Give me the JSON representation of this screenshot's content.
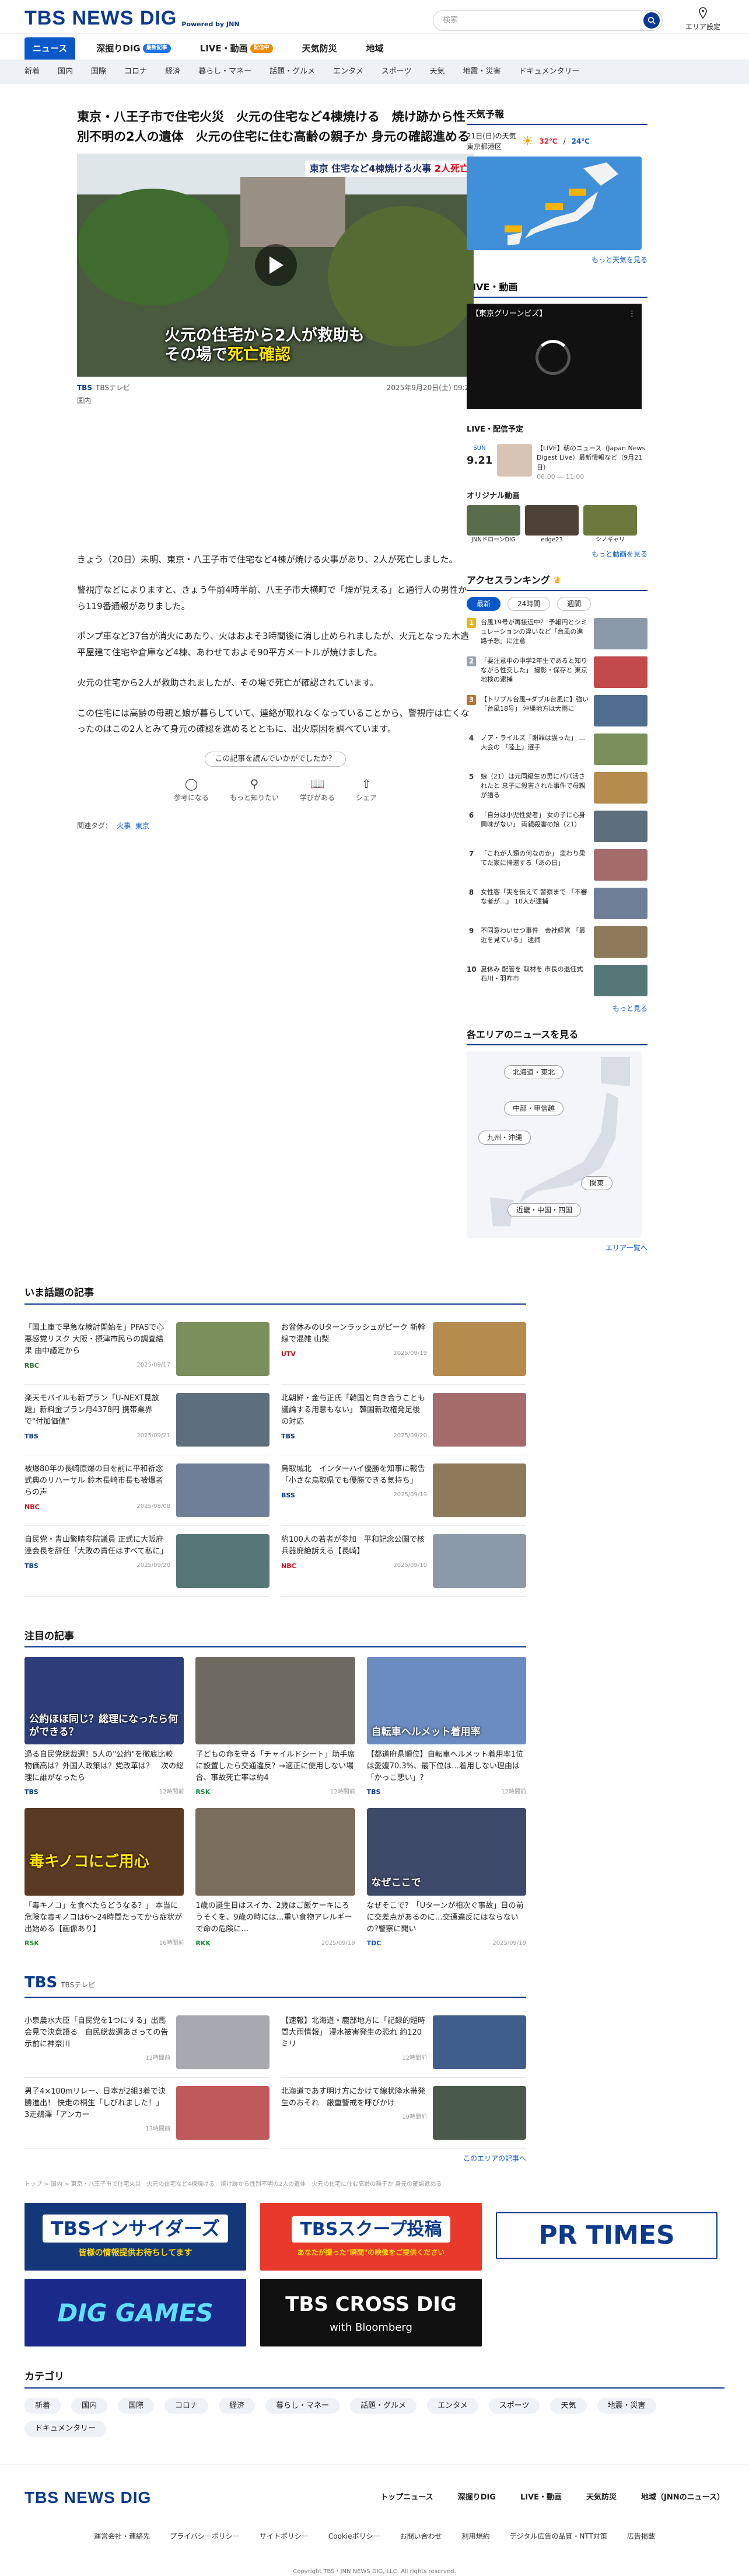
{
  "header": {
    "logo": "TBS NEWS DIG",
    "powered": "Powered by JNN",
    "search_placeholder": "検索",
    "area_label": "エリア設定"
  },
  "mainnav": [
    {
      "label": "ニュース",
      "active": true
    },
    {
      "label": "深掘りDIG",
      "badge": "最新記事"
    },
    {
      "label": "LIVE・動画",
      "badge2": "配信中"
    },
    {
      "label": "天気防災"
    },
    {
      "label": "地域"
    }
  ],
  "subnav": [
    "新着",
    "国内",
    "国際",
    "コロナ",
    "経済",
    "暮らし・マネー",
    "話題・グルメ",
    "エンタメ",
    "スポーツ",
    "天気",
    "地震・災害",
    "ドキュメンタリー"
  ],
  "article": {
    "title": "東京・八王子市で住宅火災　火元の住宅など4棟焼ける　焼け跡から性別不明の2人の遺体　火元の住宅に住む高齢の親子か 身元の確認進める",
    "video_top": "東京 住宅など4棟焼ける火事",
    "video_top_red": "2人死亡",
    "video_cap1": "火元の住宅から2人が救助も",
    "video_cap2a": "その場で",
    "video_cap2b": "死亡確認",
    "source": "TBSテレビ",
    "date": "2025年9月20日(土) 09:29",
    "category": "国内",
    "paragraphs": [
      "きょう（20日）未明、東京・八王子市で住宅など4棟が焼ける火事があり、2人が死亡しました。",
      "警視庁などによりますと、きょう午前4時半前、八王子市大横町で「煙が見える」と通行人の男性から119番通報がありました。",
      "ポンプ車など37台が消火にあたり、火はおよそ3時間後に消し止められましたが、火元となった木造平屋建て住宅や倉庫など4棟、あわせておよそ90平方メートルが焼けました。",
      "火元の住宅から2人が救助されましたが、その場で死亡が確認されています。",
      "この住宅には高齢の母親と娘が暮らしていて、連絡が取れなくなっていることから、警視庁は亡くなったのはこの2人とみて身元の確認を進めるとともに、出火原因を調べています。"
    ],
    "feedback_label": "この記事を読んでいかがでしたか？",
    "reactions": [
      "参考になる",
      "もっと知りたい",
      "学びがある",
      "シェア"
    ],
    "tags_label": "関連タグ：",
    "tags": [
      "火事",
      "東京"
    ]
  },
  "sidebar": {
    "weather_title": "天気予報",
    "weather_date": "21日(日)の天気",
    "weather_area": "東京都港区",
    "weather_high": "32℃",
    "weather_low": "24℃",
    "weather_more": "もっと天気を見る",
    "live_title": "LIVE・動画",
    "live_caption": "【東京グリーンビズ】",
    "live_sched_title": "LIVE・配信予定",
    "live_sched_date": "9.21",
    "live_sched_day": "SUN",
    "live_sched_text": "【LIVE】朝のニュース（Japan News Digest Live）最新情報など（9月21日）",
    "live_sched_time": "06:00 — 11:00",
    "original_title": "オリジナル動画",
    "original_items": [
      "JNNドローンDIG",
      "edge23",
      "シノギャリ"
    ],
    "video_more": "もっと動画を見る",
    "ranking_title": "アクセスランキング",
    "ranking_tabs": [
      "最新",
      "24時間",
      "週間"
    ],
    "ranking": [
      "台風19号が再接近中？ 予報円とシミュレーションの違いなど「台風の進路予想」に注意",
      "「要注意中の中学2年生であると知りながら性交した」 撮影・保存と 東京地検の逮捕",
      "【トリプル台風→ダブル台風に】強い「台風18号」 沖縄地方は大雨に",
      "ノア・ライルズ「謝罪は誤った」 ... 大会の 「陸上」選手",
      "娘（21）は元同級生の男にパパ活されたと 息子に殺害された事件で母親が語る",
      "「自分は小児性愛者」 女の子に心身興味がない」 両親殺害の娘（21）",
      "「これが人類の何なのか」 変わり果てた家に帰還する「あの日」",
      "女性客「実を伝えて 警察まで 「不審な者が...」 10人が逮捕",
      "不同意わいせつ事件　会社経営 「最近を見ている」 逮捕",
      "夏休み 配管を 取材を 市長の退任式 石川・羽咋市"
    ],
    "ranking_more": "もっと見る",
    "area_title": "各エリアのニュースを見る",
    "areas": [
      "北海道・東北",
      "中部・甲信越",
      "九州・沖縄",
      "関東",
      "近畿・中国・四国"
    ],
    "area_more": "エリア一覧へ"
  },
  "topics": {
    "title": "いま話題の記事",
    "items": [
      {
        "text": "「国土庫で早急な検討開始を」PFASで心悪感覚リスク 大阪・摂津市民らの調査結果 由中議定から",
        "src": "RBC",
        "date": "2025/09/17"
      },
      {
        "text": "お盆休みのUターンラッシュがピーク 新幹線で混雑 山梨",
        "src": "UTV",
        "date": "2025/09/19"
      },
      {
        "text": "楽天モバイルも新プラン「U-NEXT見放題」新料金プラン月4378円 携帯業界で\"付加価値\"",
        "src": "TBS",
        "date": "2025/09/21"
      },
      {
        "text": "北朝鮮・金与正氏「韓国と向き合うことも議論する用意もない」 韓国新政権発足後の対応",
        "src": "TBS",
        "date": "2025/09/20"
      },
      {
        "text": "被爆80年の長崎原爆の日を前に平和祈念式典のリハーサル 鈴木長崎市長も被爆者らの声",
        "src": "NBC",
        "date": "2025/08/08"
      },
      {
        "text": "鳥取城北　インターハイ優勝を知事に報告「小さな鳥取県でも優勝できる気持ち」",
        "src": "BSS",
        "date": "2025/09/19"
      },
      {
        "text": "自民党・青山繁晴参院議員 正式に大阪府連会長を辞任「大敗の責任はすべて私に」",
        "src": "TBS",
        "date": "2025/09/20"
      },
      {
        "text": "約100人の若者が参加　平和記念公園で核兵器廃絶訴える【長崎】",
        "src": "NBC",
        "date": "2025/09/10"
      }
    ]
  },
  "featured": {
    "title": "注目の記事",
    "items": [
      {
        "text": "過る自民党総裁選！5人の\"公約\"を徹底比較　物価高は？外国人政策は？党改革は？　次の総理に誰がなったら",
        "src": "TBS",
        "date": "12時間前",
        "overlay": "公約ほほ同じ？総理になったら何ができる？"
      },
      {
        "text": "子どもの命を守る「チャイルドシート」助手席に設置したら交通違反？→適正に使用しない場合、事故死亡率は約4",
        "src": "RSK",
        "date": "12時間前",
        "overlay": ""
      },
      {
        "text": "【都道府県順位】自転車ヘルメット着用率1位は愛媛70.3%、最下位は…着用しない理由は「かっこ悪い」?",
        "src": "TBS",
        "date": "12時間前",
        "overlay": "自転車ヘルメット着用率"
      },
      {
        "text": "「毒キノコ」を食べたらどうなる？」 本当に危険な毒キノコは6〜24時間たってから症状が出始める【画像あり】",
        "src": "RSK",
        "date": "16時間前",
        "overlay": "毒キノコにご用心"
      },
      {
        "text": "1歳の誕生日はスイカ、2歳はご飯ケーキにろうそくを、9歳の時には…重い食物アレルギーで命の危険に…",
        "src": "RKK",
        "date": "2025/09/19",
        "overlay": ""
      },
      {
        "text": "なぜそこで？「Uターンが相次ぐ事故」目の前に交差点があるのに…交通違反にはならないの?警察に聞い",
        "src": "TDC",
        "date": "2025/09/19",
        "overlay": "なぜここで"
      }
    ]
  },
  "tbs_section": {
    "title": "TBS",
    "sub": "TBSテレビ",
    "items": [
      {
        "text": "小泉農水大臣「自民党を1つにする」出馬会見で決意語る　自民総裁選あさっての告示前に神奈川",
        "date": "12時間前"
      },
      {
        "text": "【速報】北海道・鹿部地方に「記録的短時間大雨情報」 浸水被害発生の恐れ 約120ミリ",
        "date": "12時間前"
      },
      {
        "text": "男子4×100mリレー、日本が2組3着で決勝進出！ 快走の桐生「しびれました！」 3走鵜澤「アンカー",
        "date": "13時間前"
      },
      {
        "text": "北海道であす明け方にかけて線状降水帯発生のおそれ　厳重警戒を呼びかけ",
        "date": "19時間前"
      }
    ],
    "more": "このエリアの記事へ"
  },
  "breadcrumb": "トップ > 国内 > 東京・八王子市で住宅火災　火元の住宅など4棟焼ける　焼け跡から性別不明の2人の遺体　火元の住宅に住む高齢の親子か 身元の確認進める",
  "banners": [
    {
      "label": "TBSインサイダーズ",
      "sub": "皆様の情報提供お待ちしてます"
    },
    {
      "label": "TBSスクープ投稿",
      "sub": "あなたが撮った\"瞬間\"の映像をご提供ください"
    },
    {
      "label": "PR TIMES"
    },
    {
      "label": "DIG GAMES"
    },
    {
      "label": "TBS CROSS DIG",
      "sub": "with Bloomberg"
    }
  ],
  "categories": {
    "title": "カテゴリ",
    "items": [
      "新着",
      "国内",
      "国際",
      "コロナ",
      "経済",
      "暮らし・マネー",
      "話題・グルメ",
      "エンタメ",
      "スポーツ",
      "天気",
      "地震・災害",
      "ドキュメンタリー"
    ]
  },
  "footer": {
    "logo": "TBS NEWS DIG",
    "nav": [
      "トップニュース",
      "深掘りDIG",
      "LIVE・動画",
      "天気防災",
      "地域（JNNのニュース）"
    ],
    "links": [
      "運営会社・連絡先",
      "プライバシーポリシー",
      "サイトポリシー",
      "Cookieポリシー",
      "お問い合わせ",
      "利用規約",
      "デジタル広告の品質・NTT対策",
      "広告掲載"
    ],
    "copyright": "Copyright TBS・JNN NEWS DIG, LLC. All rights reserved."
  }
}
